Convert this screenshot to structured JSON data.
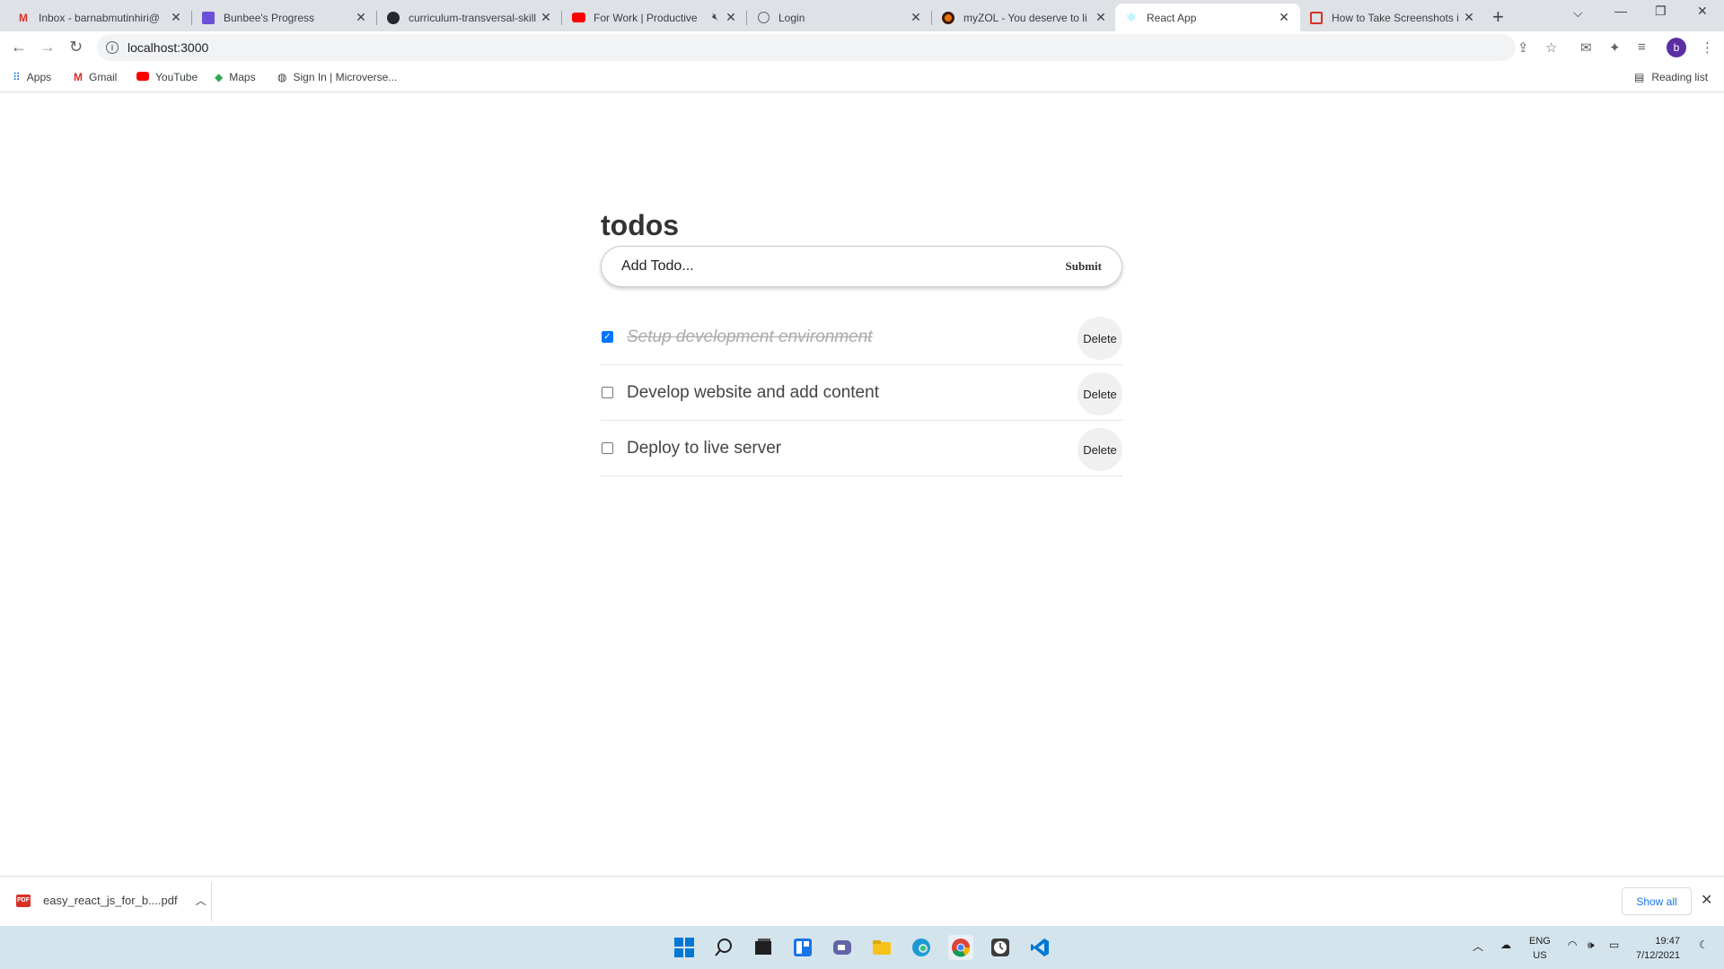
{
  "browser": {
    "tabs": [
      {
        "title": "Inbox - barnabmutinhiri@",
        "icon": "gmail-icon"
      },
      {
        "title": "Bunbee's Progress",
        "icon": "bunbee-icon"
      },
      {
        "title": "curriculum-transversal-skill",
        "icon": "github-icon"
      },
      {
        "title": "For Work | Productive",
        "icon": "youtube-icon"
      },
      {
        "title": "Login",
        "icon": "globe-icon"
      },
      {
        "title": "myZOL - You deserve to li",
        "icon": "myzol-icon"
      },
      {
        "title": "React App",
        "icon": "react-icon"
      },
      {
        "title": "How to Take Screenshots i",
        "icon": "pc-icon"
      }
    ],
    "url": "localhost:3000",
    "avatar_letter": "b",
    "bookmarks": [
      "Apps",
      "Gmail",
      "YouTube",
      "Maps",
      "Sign In | Microverse..."
    ],
    "reading_list": "Reading list"
  },
  "app": {
    "title": "todos",
    "input_placeholder": "Add Todo...",
    "submit_label": "Submit",
    "todos": [
      {
        "text": "Setup development environment",
        "completed": true,
        "delete_label": "Delete"
      },
      {
        "text": "Develop website and add content",
        "completed": false,
        "delete_label": "Delete"
      },
      {
        "text": "Deploy to live server",
        "completed": false,
        "delete_label": "Delete"
      }
    ]
  },
  "downloads": {
    "file": "easy_react_js_for_b....pdf",
    "file_badge": "PDF",
    "show_all": "Show all"
  },
  "taskbar": {
    "lang_top": "ENG",
    "lang_bottom": "US",
    "time": "19:47",
    "date": "7/12/2021"
  }
}
